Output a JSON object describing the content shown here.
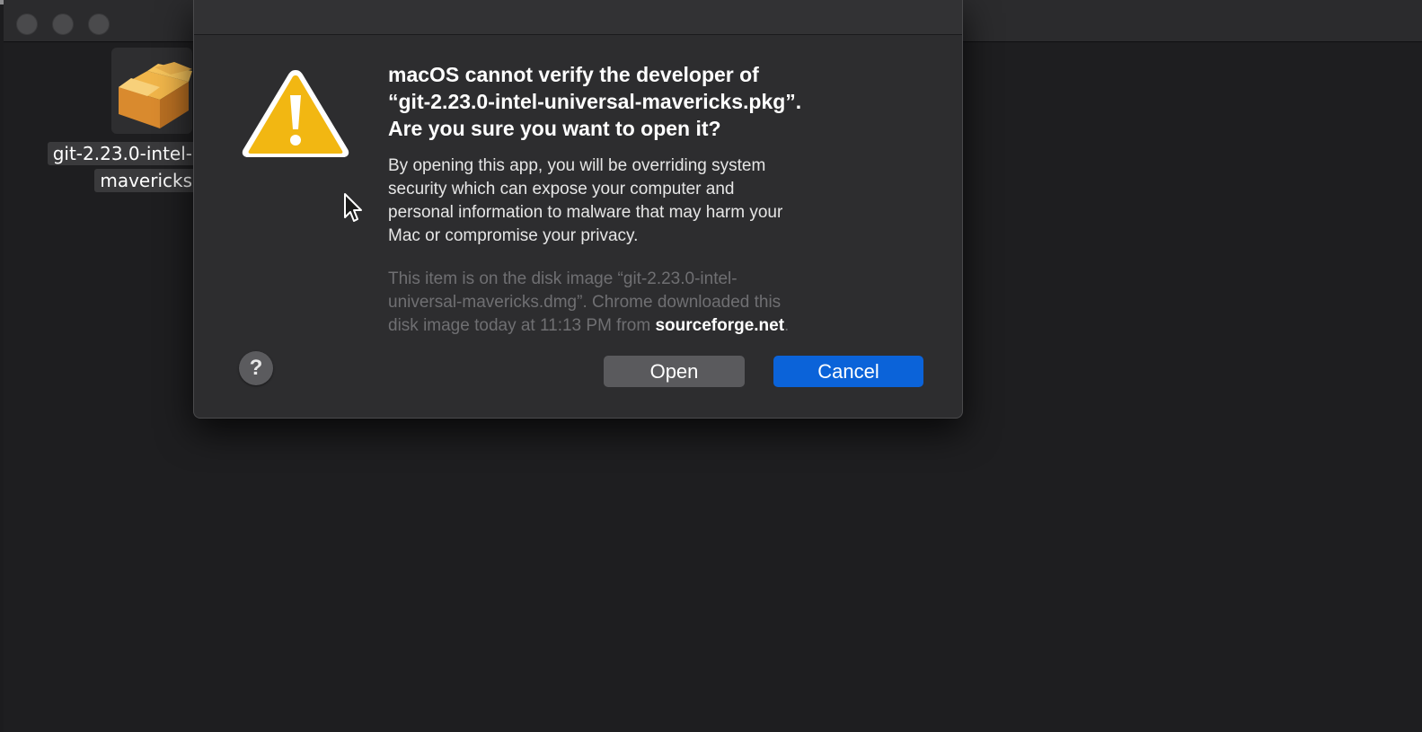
{
  "finder": {
    "file_label_line1": "git-2.23.0-intel-",
    "file_label_line2": "mavericks"
  },
  "dialog": {
    "headline_line1": "macOS cannot verify the developer of",
    "headline_line2": "“git-2.23.0-intel-universal-mavericks.pkg”.",
    "headline_line3": "Are you sure you want to open it?",
    "body_line1": "By opening this app, you will be overriding system",
    "body_line2": "security which can expose your computer and",
    "body_line3": "personal information to malware that may harm your",
    "body_line4": "Mac or compromise your privacy.",
    "source_line1": "This item is on the disk image “git-2.23.0-intel-",
    "source_line2": "universal-mavericks.dmg”. Chrome downloaded this",
    "source_line3_prefix": "disk image today at 11:13 PM from ",
    "source_link": "sourceforge.net",
    "source_line3_suffix": ".",
    "help_label": "?",
    "open_label": "Open",
    "cancel_label": "Cancel"
  },
  "icons": {
    "warning": "warning-triangle-icon",
    "package": "package-icon",
    "cursor": "mouse-pointer-icon",
    "help": "help-icon"
  },
  "colors": {
    "accent": "#0b63d9",
    "warning_yellow": "#f2b712",
    "dialog_bg": "#2d2d2f",
    "desktop_bg": "#1e1e20"
  }
}
